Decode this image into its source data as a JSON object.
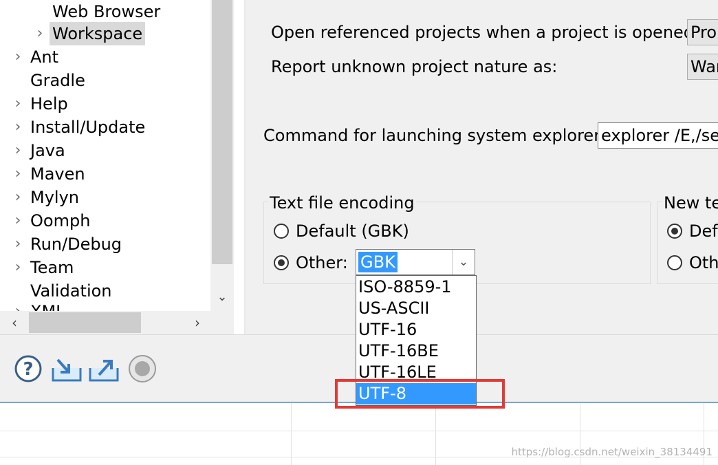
{
  "tree": {
    "items": [
      {
        "label": "Web Browser",
        "arrow": false
      },
      {
        "label": "Workspace",
        "arrow": true,
        "selected": true
      },
      {
        "label": "Ant",
        "arrow": true
      },
      {
        "label": "Gradle",
        "arrow": false
      },
      {
        "label": "Help",
        "arrow": true
      },
      {
        "label": "Install/Update",
        "arrow": true
      },
      {
        "label": "Java",
        "arrow": true
      },
      {
        "label": "Maven",
        "arrow": true
      },
      {
        "label": "Mylyn",
        "arrow": true
      },
      {
        "label": "Oomph",
        "arrow": true
      },
      {
        "label": "Run/Debug",
        "arrow": true
      },
      {
        "label": "Team",
        "arrow": true
      },
      {
        "label": "Validation",
        "arrow": false
      },
      {
        "label": "XML",
        "arrow": true
      }
    ]
  },
  "workspace": {
    "open_ref_label": "Open referenced projects when a project is opened:",
    "open_ref_value": "Pro",
    "report_unknown_label": "Report unknown project nature as:",
    "report_unknown_value": "War",
    "explorer_label": "Command for launching system explorer:",
    "explorer_value": "explorer /E,/sel",
    "encoding_group": {
      "title": "Text file encoding",
      "default_label": "Default (GBK)",
      "other_label": "Other:",
      "selected": "other",
      "combo_value": "GBK",
      "options": [
        "ISO-8859-1",
        "US-ASCII",
        "UTF-16",
        "UTF-16BE",
        "UTF-16LE",
        "UTF-8"
      ],
      "highlighted_option": "UTF-8"
    },
    "delimiter_group": {
      "title": "New te",
      "default_label": "Defa",
      "other_label": "Oth",
      "selected": "default"
    }
  },
  "watermark": "https://blog.csdn.net/weixin_38134491",
  "colors": {
    "selection": "#3399ff",
    "highlight_box": "#e53935"
  }
}
